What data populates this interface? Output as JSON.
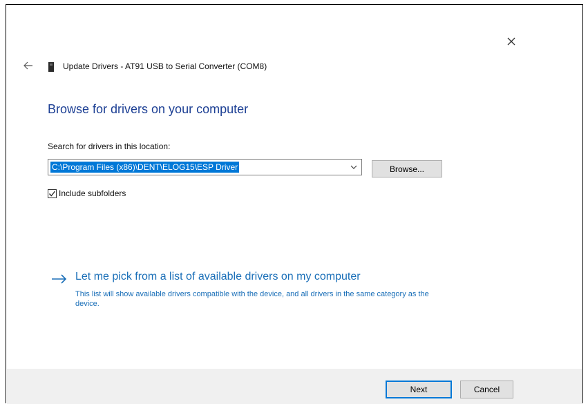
{
  "window": {
    "title": "Update Drivers - AT91 USB to Serial Converter (COM8)",
    "close_icon": "close-icon",
    "back_icon": "back-arrow-icon",
    "device_icon": "device-icon"
  },
  "page": {
    "heading": "Browse for drivers on your computer",
    "search_label": "Search for drivers in this location:",
    "path_value": "C:\\Program Files (x86)\\DENT\\ELOG15\\ESP Driver",
    "browse_label": "Browse...",
    "include_subfolders_label": "Include subfolders",
    "include_subfolders_checked": true,
    "pick_link_title": "Let me pick from a list of available drivers on my computer",
    "pick_link_desc": "This list will show available drivers compatible with the device, and all drivers in the same category as the device."
  },
  "footer": {
    "next_label": "Next",
    "cancel_label": "Cancel"
  },
  "colors": {
    "heading": "#1c3f94",
    "link": "#1a6fb8",
    "selection": "#0078d7",
    "footer_bg": "#f0f0f0"
  }
}
